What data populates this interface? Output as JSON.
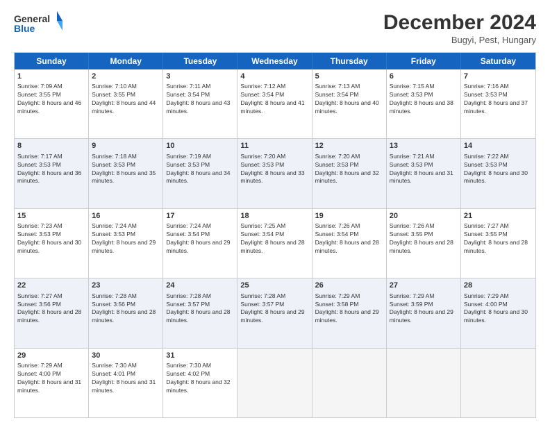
{
  "logo": {
    "line1": "General",
    "line2": "Blue"
  },
  "title": "December 2024",
  "location": "Bugyi, Pest, Hungary",
  "weekdays": [
    "Sunday",
    "Monday",
    "Tuesday",
    "Wednesday",
    "Thursday",
    "Friday",
    "Saturday"
  ],
  "weeks": [
    [
      {
        "day": "1",
        "sunrise": "Sunrise: 7:09 AM",
        "sunset": "Sunset: 3:55 PM",
        "daylight": "Daylight: 8 hours and 46 minutes."
      },
      {
        "day": "2",
        "sunrise": "Sunrise: 7:10 AM",
        "sunset": "Sunset: 3:55 PM",
        "daylight": "Daylight: 8 hours and 44 minutes."
      },
      {
        "day": "3",
        "sunrise": "Sunrise: 7:11 AM",
        "sunset": "Sunset: 3:54 PM",
        "daylight": "Daylight: 8 hours and 43 minutes."
      },
      {
        "day": "4",
        "sunrise": "Sunrise: 7:12 AM",
        "sunset": "Sunset: 3:54 PM",
        "daylight": "Daylight: 8 hours and 41 minutes."
      },
      {
        "day": "5",
        "sunrise": "Sunrise: 7:13 AM",
        "sunset": "Sunset: 3:54 PM",
        "daylight": "Daylight: 8 hours and 40 minutes."
      },
      {
        "day": "6",
        "sunrise": "Sunrise: 7:15 AM",
        "sunset": "Sunset: 3:53 PM",
        "daylight": "Daylight: 8 hours and 38 minutes."
      },
      {
        "day": "7",
        "sunrise": "Sunrise: 7:16 AM",
        "sunset": "Sunset: 3:53 PM",
        "daylight": "Daylight: 8 hours and 37 minutes."
      }
    ],
    [
      {
        "day": "8",
        "sunrise": "Sunrise: 7:17 AM",
        "sunset": "Sunset: 3:53 PM",
        "daylight": "Daylight: 8 hours and 36 minutes."
      },
      {
        "day": "9",
        "sunrise": "Sunrise: 7:18 AM",
        "sunset": "Sunset: 3:53 PM",
        "daylight": "Daylight: 8 hours and 35 minutes."
      },
      {
        "day": "10",
        "sunrise": "Sunrise: 7:19 AM",
        "sunset": "Sunset: 3:53 PM",
        "daylight": "Daylight: 8 hours and 34 minutes."
      },
      {
        "day": "11",
        "sunrise": "Sunrise: 7:20 AM",
        "sunset": "Sunset: 3:53 PM",
        "daylight": "Daylight: 8 hours and 33 minutes."
      },
      {
        "day": "12",
        "sunrise": "Sunrise: 7:20 AM",
        "sunset": "Sunset: 3:53 PM",
        "daylight": "Daylight: 8 hours and 32 minutes."
      },
      {
        "day": "13",
        "sunrise": "Sunrise: 7:21 AM",
        "sunset": "Sunset: 3:53 PM",
        "daylight": "Daylight: 8 hours and 31 minutes."
      },
      {
        "day": "14",
        "sunrise": "Sunrise: 7:22 AM",
        "sunset": "Sunset: 3:53 PM",
        "daylight": "Daylight: 8 hours and 30 minutes."
      }
    ],
    [
      {
        "day": "15",
        "sunrise": "Sunrise: 7:23 AM",
        "sunset": "Sunset: 3:53 PM",
        "daylight": "Daylight: 8 hours and 30 minutes."
      },
      {
        "day": "16",
        "sunrise": "Sunrise: 7:24 AM",
        "sunset": "Sunset: 3:53 PM",
        "daylight": "Daylight: 8 hours and 29 minutes."
      },
      {
        "day": "17",
        "sunrise": "Sunrise: 7:24 AM",
        "sunset": "Sunset: 3:54 PM",
        "daylight": "Daylight: 8 hours and 29 minutes."
      },
      {
        "day": "18",
        "sunrise": "Sunrise: 7:25 AM",
        "sunset": "Sunset: 3:54 PM",
        "daylight": "Daylight: 8 hours and 28 minutes."
      },
      {
        "day": "19",
        "sunrise": "Sunrise: 7:26 AM",
        "sunset": "Sunset: 3:54 PM",
        "daylight": "Daylight: 8 hours and 28 minutes."
      },
      {
        "day": "20",
        "sunrise": "Sunrise: 7:26 AM",
        "sunset": "Sunset: 3:55 PM",
        "daylight": "Daylight: 8 hours and 28 minutes."
      },
      {
        "day": "21",
        "sunrise": "Sunrise: 7:27 AM",
        "sunset": "Sunset: 3:55 PM",
        "daylight": "Daylight: 8 hours and 28 minutes."
      }
    ],
    [
      {
        "day": "22",
        "sunrise": "Sunrise: 7:27 AM",
        "sunset": "Sunset: 3:56 PM",
        "daylight": "Daylight: 8 hours and 28 minutes."
      },
      {
        "day": "23",
        "sunrise": "Sunrise: 7:28 AM",
        "sunset": "Sunset: 3:56 PM",
        "daylight": "Daylight: 8 hours and 28 minutes."
      },
      {
        "day": "24",
        "sunrise": "Sunrise: 7:28 AM",
        "sunset": "Sunset: 3:57 PM",
        "daylight": "Daylight: 8 hours and 28 minutes."
      },
      {
        "day": "25",
        "sunrise": "Sunrise: 7:28 AM",
        "sunset": "Sunset: 3:57 PM",
        "daylight": "Daylight: 8 hours and 29 minutes."
      },
      {
        "day": "26",
        "sunrise": "Sunrise: 7:29 AM",
        "sunset": "Sunset: 3:58 PM",
        "daylight": "Daylight: 8 hours and 29 minutes."
      },
      {
        "day": "27",
        "sunrise": "Sunrise: 7:29 AM",
        "sunset": "Sunset: 3:59 PM",
        "daylight": "Daylight: 8 hours and 29 minutes."
      },
      {
        "day": "28",
        "sunrise": "Sunrise: 7:29 AM",
        "sunset": "Sunset: 4:00 PM",
        "daylight": "Daylight: 8 hours and 30 minutes."
      }
    ],
    [
      {
        "day": "29",
        "sunrise": "Sunrise: 7:29 AM",
        "sunset": "Sunset: 4:00 PM",
        "daylight": "Daylight: 8 hours and 31 minutes."
      },
      {
        "day": "30",
        "sunrise": "Sunrise: 7:30 AM",
        "sunset": "Sunset: 4:01 PM",
        "daylight": "Daylight: 8 hours and 31 minutes."
      },
      {
        "day": "31",
        "sunrise": "Sunrise: 7:30 AM",
        "sunset": "Sunset: 4:02 PM",
        "daylight": "Daylight: 8 hours and 32 minutes."
      },
      null,
      null,
      null,
      null
    ]
  ]
}
